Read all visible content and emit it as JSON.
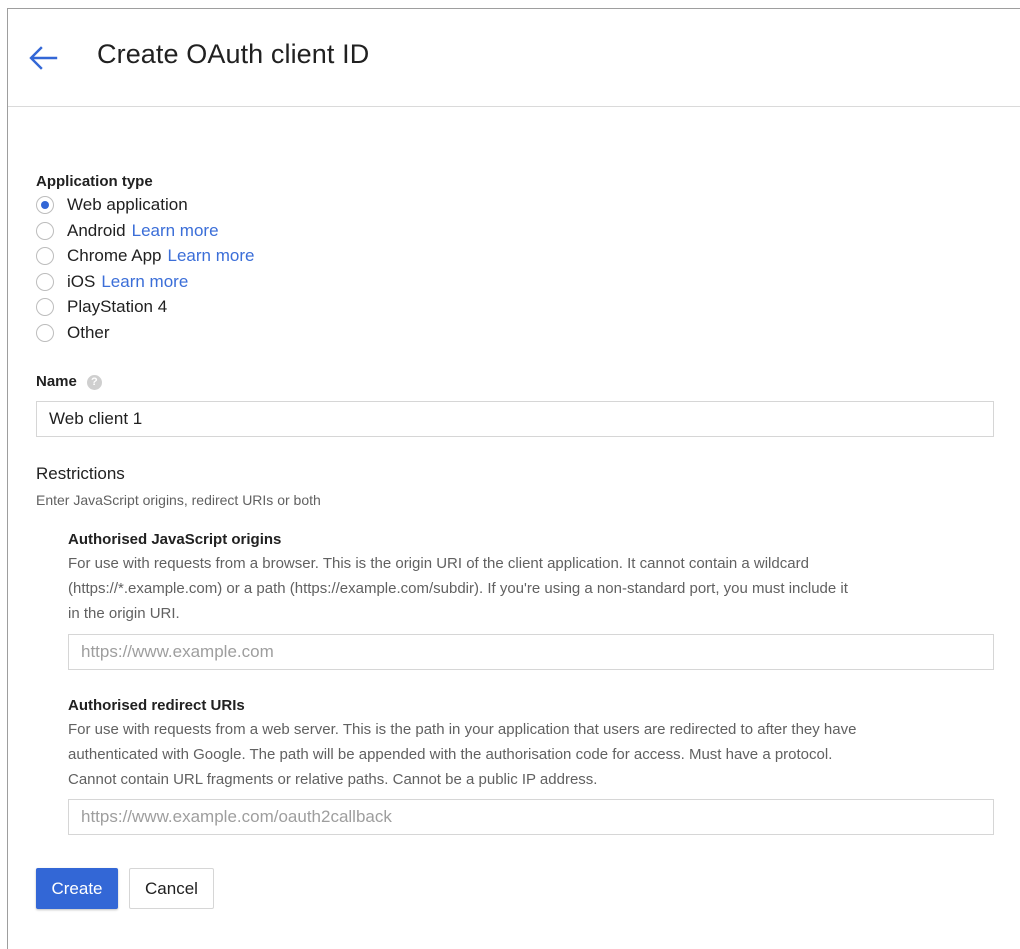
{
  "header": {
    "title": "Create OAuth client ID"
  },
  "app_type": {
    "label": "Application type",
    "options": [
      {
        "label": "Web application",
        "link": "",
        "checked": true
      },
      {
        "label": "Android",
        "link": "Learn more",
        "checked": false
      },
      {
        "label": "Chrome App",
        "link": "Learn more",
        "checked": false
      },
      {
        "label": "iOS",
        "link": "Learn more",
        "checked": false
      },
      {
        "label": "PlayStation 4",
        "link": "",
        "checked": false
      },
      {
        "label": "Other",
        "link": "",
        "checked": false
      }
    ]
  },
  "name": {
    "label": "Name",
    "help_icon": "help-icon",
    "value": "Web client 1"
  },
  "restrictions": {
    "title": "Restrictions",
    "subtitle": "Enter JavaScript origins, redirect URIs or both",
    "js_origins": {
      "title": "Authorised JavaScript origins",
      "help_lines": [
        "For use with requests from a browser. This is the origin URI of the client application. It cannot contain a wildcard",
        "(https://*.example.com) or a path (https://example.com/subdir). If you're using a non-standard port, you must include it",
        "in the origin URI."
      ],
      "placeholder": "https://www.example.com"
    },
    "redirect_uris": {
      "title": "Authorised redirect URIs",
      "help_lines": [
        "For use with requests from a web server. This is the path in your application that users are redirected to after they have",
        "authenticated with Google. The path will be appended with the authorisation code for access. Must have a protocol.",
        "Cannot contain URL fragments or relative paths. Cannot be a public IP address."
      ],
      "placeholder": "https://www.example.com/oauth2callback"
    }
  },
  "actions": {
    "create_label": "Create",
    "cancel_label": "Cancel"
  },
  "colors": {
    "accent": "#3367d6",
    "link": "#3b6ed8",
    "help_text": "#616161"
  }
}
